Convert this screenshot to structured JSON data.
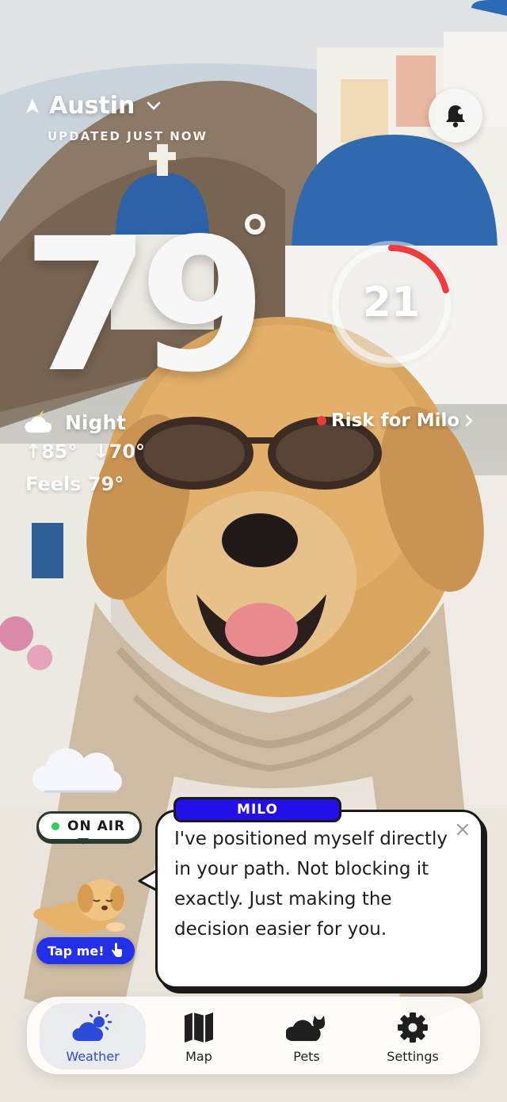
{
  "header": {
    "city": "Austin",
    "updated": "UPDATED JUST NOW"
  },
  "weather": {
    "temperature": "79",
    "condition": "Night",
    "high": "85°",
    "low": "70°",
    "feels_like": "Feels 79°"
  },
  "risk": {
    "value": "21",
    "level_fraction": 0.21,
    "label": "Risk for Milo",
    "accent": "#ef3b3b"
  },
  "mascot": {
    "on_air": "ON AIR",
    "tap_label": "Tap me!",
    "name": "MILO",
    "message": "I've positioned myself directly in your path. Not blocking it exactly. Just making the decision easier for you."
  },
  "nav": {
    "items": [
      {
        "label": "Weather",
        "icon": "cloud-sun-icon"
      },
      {
        "label": "Map",
        "icon": "map-icon"
      },
      {
        "label": "Pets",
        "icon": "cloud-cat-icon"
      },
      {
        "label": "Settings",
        "icon": "gear-icon"
      }
    ],
    "active": "Weather",
    "accent": "#2d4ad8"
  }
}
